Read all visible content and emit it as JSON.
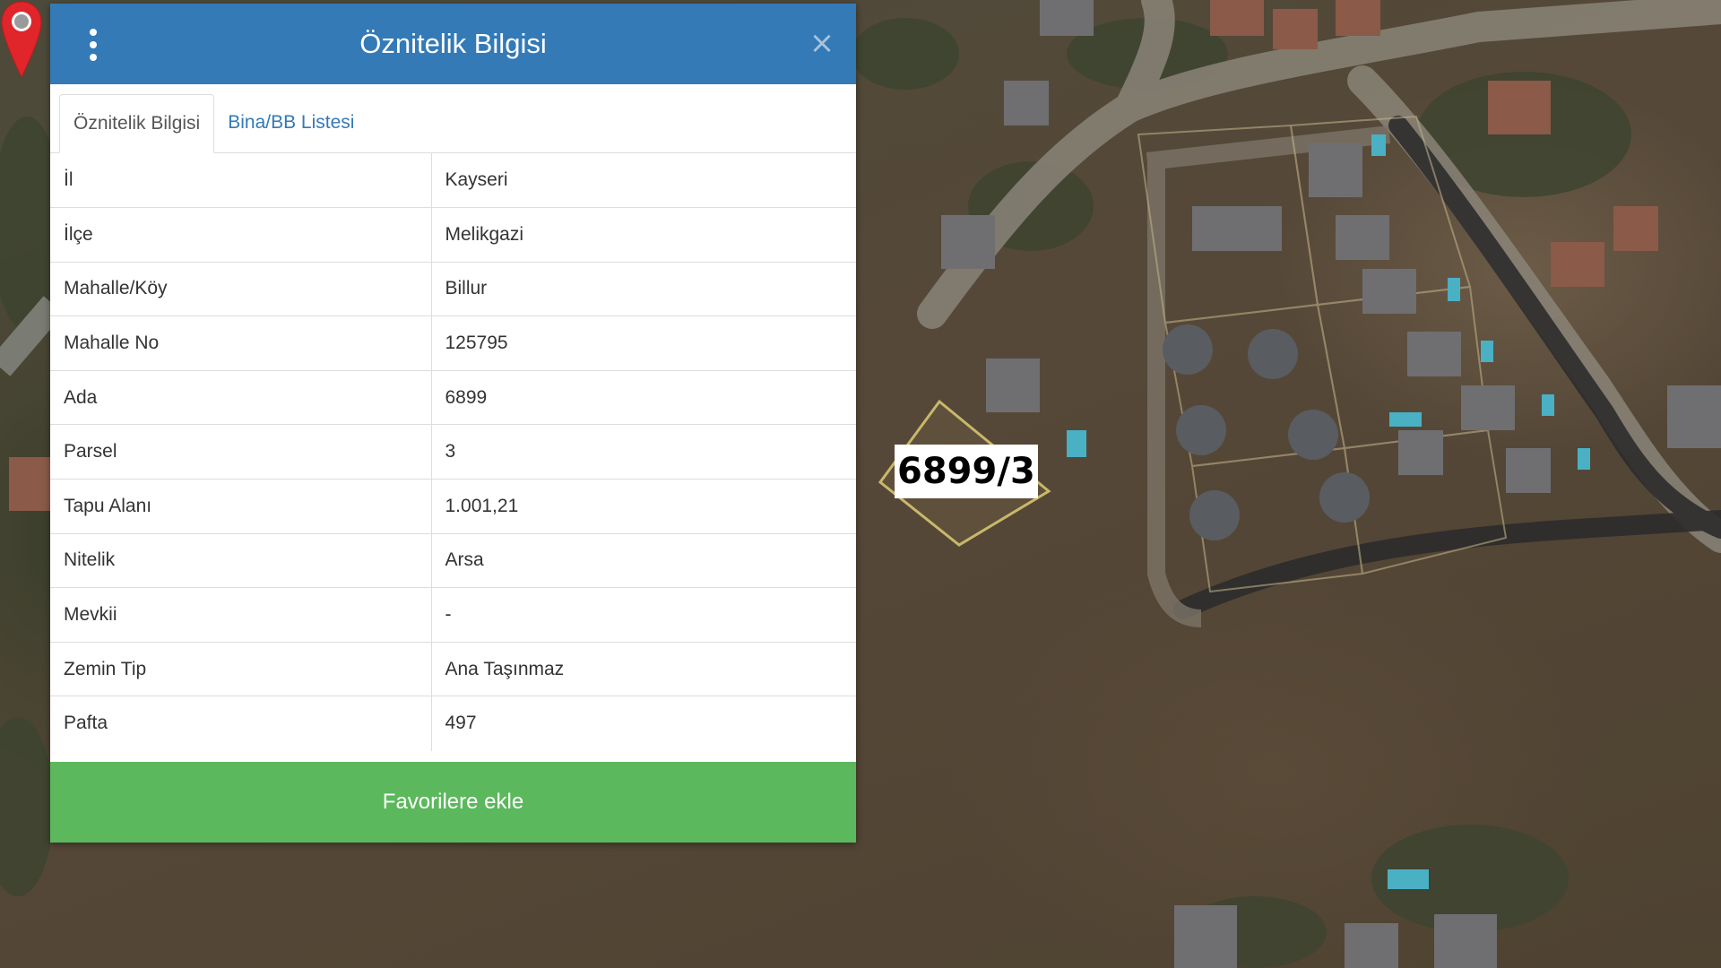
{
  "panel": {
    "title": "Öznitelik Bilgisi",
    "menu_icon": "kebab-menu-icon",
    "close_icon": "close-icon",
    "close_glyph": "×",
    "tabs": [
      {
        "label": "Öznitelik Bilgisi",
        "active": true
      },
      {
        "label": "Bina/BB Listesi",
        "active": false
      }
    ],
    "rows": [
      {
        "key": "İl",
        "value": "Kayseri"
      },
      {
        "key": "İlçe",
        "value": "Melikgazi"
      },
      {
        "key": "Mahalle/Köy",
        "value": "Billur"
      },
      {
        "key": "Mahalle No",
        "value": "125795"
      },
      {
        "key": "Ada",
        "value": "6899"
      },
      {
        "key": "Parsel",
        "value": "3"
      },
      {
        "key": "Tapu Alanı",
        "value": "1.001,21"
      },
      {
        "key": "Nitelik",
        "value": "Arsa"
      },
      {
        "key": "Mevkii",
        "value": "-"
      },
      {
        "key": "Zemin Tip",
        "value": "Ana Taşınmaz"
      },
      {
        "key": "Pafta",
        "value": "497"
      }
    ],
    "favorite_button": "Favorilere ekle"
  },
  "map": {
    "parcel_label": "6899/3",
    "pin_icon": "map-pin-icon",
    "colors": {
      "header": "#337ab7",
      "favorite": "#5cb85c",
      "pin": "#e0252b",
      "parcel_outline": "#c9b86a"
    }
  }
}
